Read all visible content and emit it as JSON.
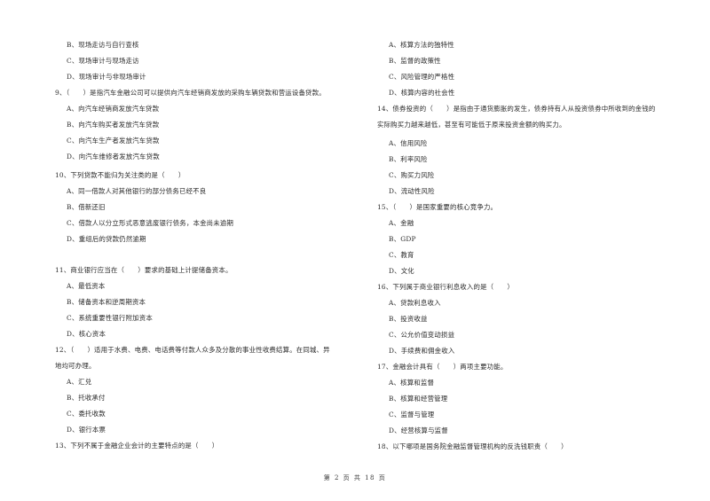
{
  "left_column": {
    "items": [
      {
        "kind": "o",
        "text": "B、现场走访与自行查核"
      },
      {
        "kind": "o",
        "text": "C、现场审计与现场走访"
      },
      {
        "kind": "o",
        "text": "D、现场审计与非现场审计"
      },
      {
        "kind": "q",
        "text": "9、（　　）是指汽车金融公司可以提供向汽车经销商发放的采购车辆贷款和营运设备贷款。"
      },
      {
        "kind": "o",
        "text": "A、向汽车经销商发放汽车贷款"
      },
      {
        "kind": "o",
        "text": "B、向汽车购买者发放汽车贷款"
      },
      {
        "kind": "o",
        "text": "C、向汽车生产者发放汽车贷款"
      },
      {
        "kind": "o",
        "text": "D、向汽车维修者发放汽车贷款"
      },
      {
        "kind": "q",
        "text": "10、下列贷款不能归为关注类的是（　　）"
      },
      {
        "kind": "o",
        "text": "A、同一借款人对其他银行的部分债务已经不良"
      },
      {
        "kind": "o",
        "text": "B、借新还旧"
      },
      {
        "kind": "o",
        "text": "C、借款人以分立形式恶意逃废银行债务，本金尚未逾期"
      },
      {
        "kind": "o",
        "text": "D、重组后的贷款仍然逾期"
      },
      {
        "kind": "q",
        "text": "11、商业银行应当在（　　）要求的基础上计提储备资本。"
      },
      {
        "kind": "o",
        "text": "A、最低资本"
      },
      {
        "kind": "o",
        "text": "B、储备资本和逆周期资本"
      },
      {
        "kind": "o",
        "text": "C、系统重要性银行附加资本"
      },
      {
        "kind": "o",
        "text": "D、核心资本"
      },
      {
        "kind": "q",
        "text": "12、（　　）适用于水费、电费、电话费等付款人众多及分散的事业性收费结算。在同城、异"
      },
      {
        "kind": "q",
        "text": "地均可办理。"
      },
      {
        "kind": "o",
        "text": "A、汇兑"
      },
      {
        "kind": "o",
        "text": "B、托收承付"
      },
      {
        "kind": "o",
        "text": "C、委托收款"
      },
      {
        "kind": "o",
        "text": "D、银行本票"
      },
      {
        "kind": "q",
        "text": "13、下列不属于金融企业会计的主要特点的是（　　）"
      }
    ]
  },
  "right_column": {
    "items": [
      {
        "kind": "o",
        "text": "A、核算方法的独特性"
      },
      {
        "kind": "o",
        "text": "B、监督的政策性"
      },
      {
        "kind": "o",
        "text": "C、风险管理的严格性"
      },
      {
        "kind": "o",
        "text": "D、核算内容的社会性"
      },
      {
        "kind": "q",
        "text": "14、债券投资的（　　）是指由于通货膨胀的发生，债券持有人从投资债券中所收到的金钱的"
      },
      {
        "kind": "q",
        "text": "实际购买力越来越低，甚至有可能低于原来投资金额的购买力。"
      },
      {
        "kind": "o",
        "text": "A、信用风险"
      },
      {
        "kind": "o",
        "text": "B、利率风险"
      },
      {
        "kind": "o",
        "text": "C、购买力风险"
      },
      {
        "kind": "o",
        "text": "D、流动性风险"
      },
      {
        "kind": "q",
        "text": "15、（　　）是国家重要的核心竞争力。"
      },
      {
        "kind": "o",
        "text": "A、金融"
      },
      {
        "kind": "o",
        "text": "B、GDP"
      },
      {
        "kind": "o",
        "text": "C、教育"
      },
      {
        "kind": "o",
        "text": "D、文化"
      },
      {
        "kind": "q",
        "text": "16、下列属于商业银行利息收入的是（　　）"
      },
      {
        "kind": "o",
        "text": "A、贷款利息收入"
      },
      {
        "kind": "o",
        "text": "B、投资收益"
      },
      {
        "kind": "o",
        "text": "C、公允价值变动损益"
      },
      {
        "kind": "o",
        "text": "D、手续费和佣金收入"
      },
      {
        "kind": "q",
        "text": "17、金融会计具有（　　）两项主要功能。"
      },
      {
        "kind": "o",
        "text": "A、核算和监督"
      },
      {
        "kind": "o",
        "text": "B、核算和经营管理"
      },
      {
        "kind": "o",
        "text": "C、监督与管理"
      },
      {
        "kind": "o",
        "text": "D、经营核算与监督"
      },
      {
        "kind": "q",
        "text": "18、以下哪项是国务院金融监督管理机构的反洗钱职责（　　）"
      }
    ]
  },
  "footer": {
    "page_label": "第 2 页 共 18 页"
  }
}
